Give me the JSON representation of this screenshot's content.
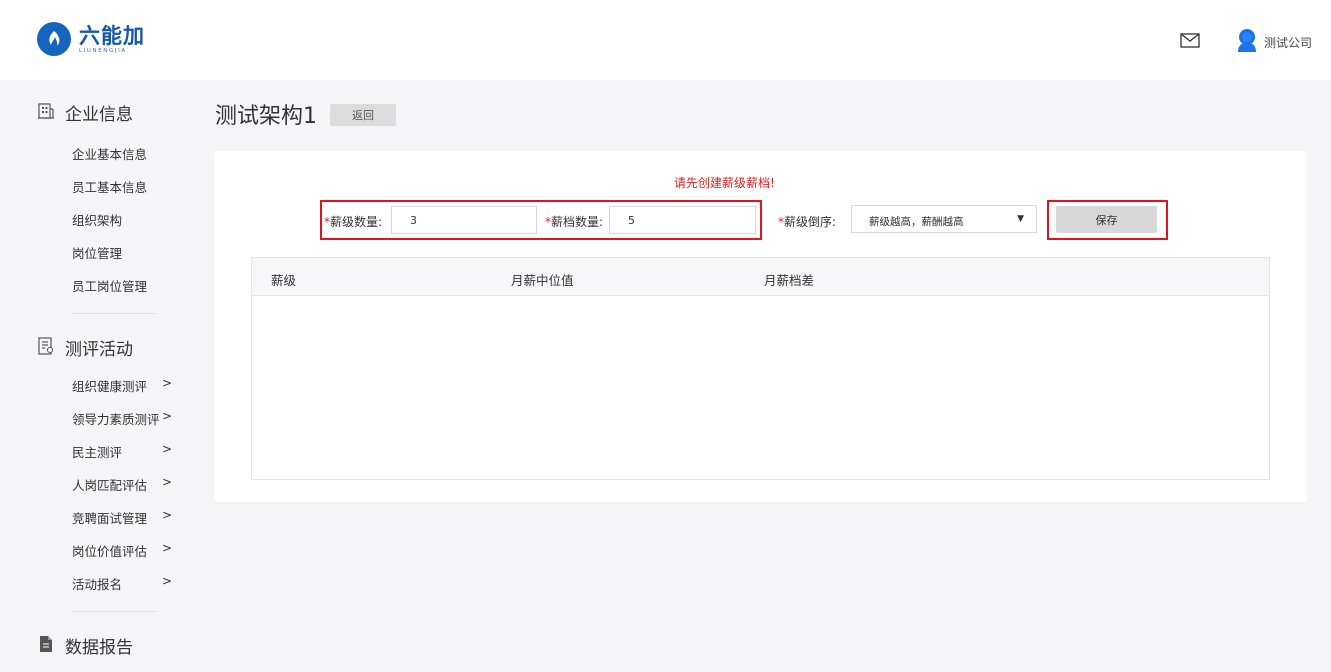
{
  "header": {
    "logo_text": "六能加",
    "logo_sub": "LIUNENGJIA",
    "company": "测试公司"
  },
  "sidebar": {
    "sections": [
      {
        "title": "企业信息",
        "icon": "building-icon",
        "items": [
          "企业基本信息",
          "员工基本信息",
          "组织架构",
          "岗位管理",
          "员工岗位管理"
        ]
      },
      {
        "title": "测评活动",
        "icon": "assessment-icon",
        "items": [
          "组织健康测评",
          "领导力素质测评",
          "民主测评",
          "人岗匹配评估",
          "竞聘面试管理",
          "岗位价值评估",
          "活动报名"
        ]
      },
      {
        "title": "数据报告",
        "icon": "document-icon",
        "items": []
      }
    ],
    "chevron": ">"
  },
  "main": {
    "title": "测试架构1",
    "back_label": "返回",
    "warning": "请先创建薪级薪档!",
    "form": {
      "star": "*",
      "grade_count_label": "薪级数量:",
      "grade_count_value": "3",
      "band_count_label": "薪档数量:",
      "band_count_value": "5",
      "order_label": "薪级倒序:",
      "order_value": "薪级越高，薪酬越高",
      "save_label": "保存"
    },
    "table": {
      "columns": [
        "薪级",
        "月薪中位值",
        "月薪档差"
      ],
      "rows": []
    }
  }
}
